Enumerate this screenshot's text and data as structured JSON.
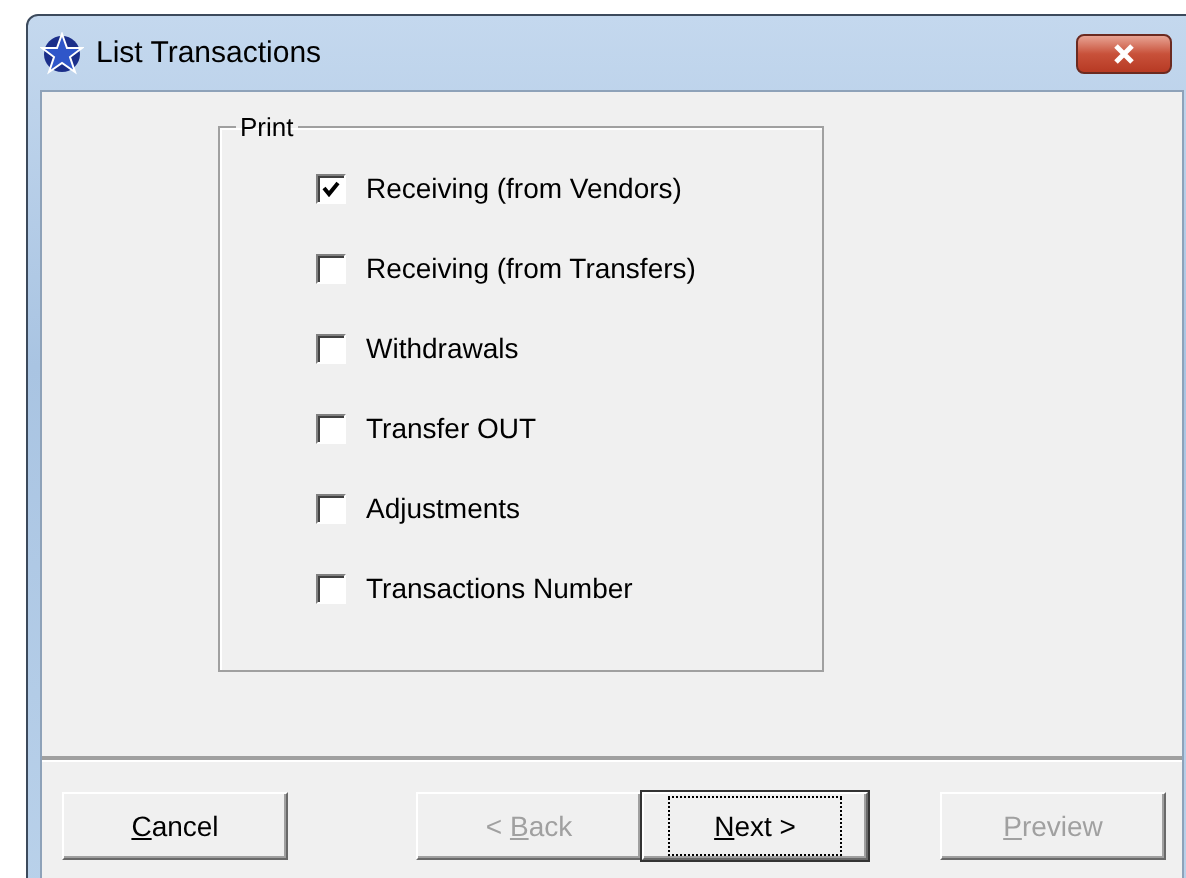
{
  "window": {
    "title": "List Transactions"
  },
  "print_group": {
    "label": "Print",
    "options": [
      {
        "label": "Receiving (from Vendors)",
        "checked": true
      },
      {
        "label": "Receiving (from Transfers)",
        "checked": false
      },
      {
        "label": "Withdrawals",
        "checked": false
      },
      {
        "label": "Transfer OUT",
        "checked": false
      },
      {
        "label": "Adjustments",
        "checked": false
      },
      {
        "label": "Transactions Number",
        "checked": false
      }
    ]
  },
  "buttons": [
    {
      "mnemonic": "C",
      "rest": "ancel",
      "disabled": false,
      "default": false
    },
    {
      "prefix": "< ",
      "mnemonic": "B",
      "rest": "ack",
      "disabled": true,
      "default": false
    },
    {
      "mnemonic": "N",
      "rest": "ext >",
      "disabled": false,
      "default": true
    },
    {
      "mnemonic": "P",
      "rest": "review",
      "disabled": true,
      "default": false
    }
  ]
}
